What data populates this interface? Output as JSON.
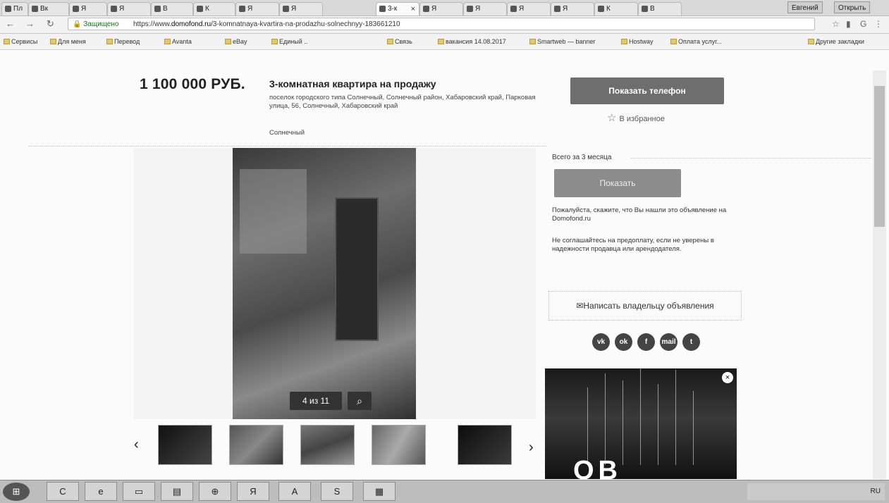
{
  "browser": {
    "tabs": [
      {
        "label": "Пл"
      },
      {
        "label": "Вк"
      },
      {
        "label": "Я"
      },
      {
        "label": "Я"
      },
      {
        "label": "В"
      },
      {
        "label": "К"
      },
      {
        "label": "Я"
      },
      {
        "label": "Я"
      },
      {
        "label": "3-к"
      },
      {
        "label": "Я"
      },
      {
        "label": "Я"
      },
      {
        "label": "Я"
      },
      {
        "label": "Я"
      },
      {
        "label": "К"
      },
      {
        "label": "В"
      }
    ],
    "window_buttons": [
      "Евгений",
      "Открыть"
    ],
    "secure_label": "Защищено",
    "url_prefix": "https://www.",
    "url_domain": "domofond.ru",
    "url_rest": "/3-komnatnaya-kvartira-na-prodazhu-solnechnyy-183661210",
    "bookmarks": [
      "Сервисы",
      "Для меня",
      "Перевод",
      "Avanta",
      "eBay",
      "Единый ..",
      "Связь",
      "вакансия 14.08.2017",
      "Smartweb — banner",
      "Hostway",
      "Оплата услуг...",
      "Другие закладки"
    ]
  },
  "listing": {
    "price": "1 100 000 РУБ.",
    "title": "3-комнатная квартира на продажу",
    "address": "поселок городского типа Солнечный, Солнечный район, Хабаровский край, Парковая улица, 56, Солнечный, Хабаровский край",
    "district": "Солнечный",
    "phone_button": "Показать телефон",
    "favorite_label": "В избранное",
    "photo_counter": "4 из 11",
    "prev_arrow": "‹",
    "next_arrow": "›",
    "zoom_icon": "magnifier-icon"
  },
  "sidebar": {
    "viewed": "Всего за 3 месяца",
    "mid_button": "Показать",
    "notice1": "Пожалуйста, скажите, что Вы нашли это объявление на Domofond.ru",
    "notice2": "Не соглашайтесь на предоплату, если не уверены в надежности продавца или арендодателя.",
    "write_button": "Написать владельцу объявления",
    "social": [
      "vk",
      "ok",
      "f",
      "mail",
      "t"
    ],
    "ad_brand": "ОВ",
    "ad_close": "×"
  },
  "taskbar": {
    "start": "⊞",
    "items": [
      "C",
      "e",
      "▭",
      "▤",
      "⊕",
      "Я",
      "A",
      "S",
      "▦"
    ],
    "tray": "RU"
  }
}
